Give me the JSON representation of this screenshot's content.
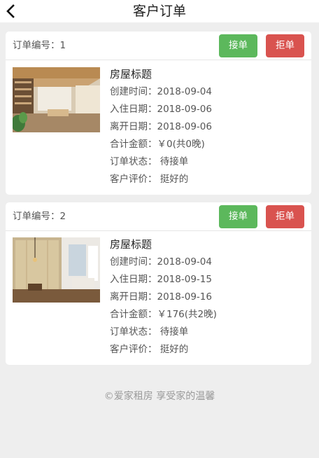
{
  "header": {
    "title": "客户订单"
  },
  "orders": [
    {
      "order_no_label": "订单编号：1",
      "accept_label": "接单",
      "reject_label": "拒单",
      "title": "房屋标题",
      "created": "创建时间：2018-09-04",
      "checkin": "入住日期：2018-09-06",
      "checkout": "离开日期：2018-09-06",
      "amount": "合计金额：￥0(共0晚)",
      "status": "订单状态： 待接单",
      "review": "客户评价： 挺好的"
    },
    {
      "order_no_label": "订单编号：2",
      "accept_label": "接单",
      "reject_label": "拒单",
      "title": "房屋标题",
      "created": "创建时间：2018-09-04",
      "checkin": "入住日期：2018-09-15",
      "checkout": "离开日期：2018-09-16",
      "amount": "合计金额：￥176(共2晚)",
      "status": "订单状态： 待接单",
      "review": "客户评价： 挺好的"
    }
  ],
  "footer": {
    "text": "©爱家租房 享受家的温馨"
  },
  "colors": {
    "accept": "#5cb85c",
    "reject": "#d9534f",
    "background": "#eeeeee"
  }
}
